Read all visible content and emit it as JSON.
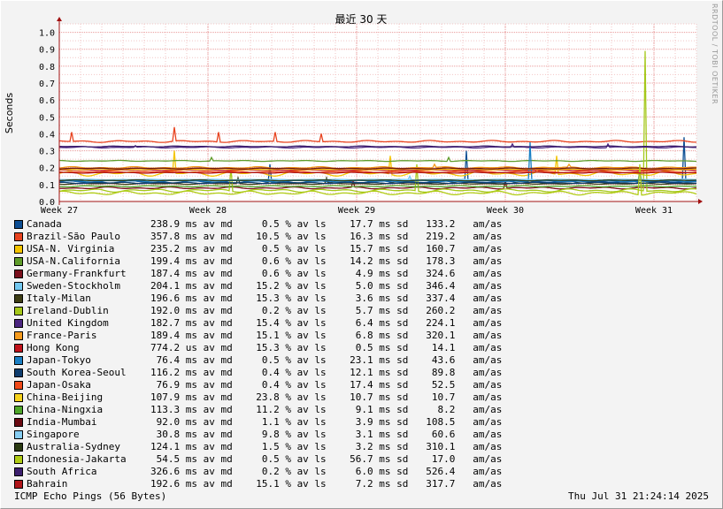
{
  "chart_data": {
    "type": "line",
    "title": "最近 30 天",
    "ylabel": "Seconds",
    "ylim": [
      0,
      1.05
    ],
    "yticks": [
      "0.0",
      "0.1",
      "0.2",
      "0.3",
      "0.4",
      "0.5",
      "0.6",
      "0.7",
      "0.8",
      "0.9",
      "1.0"
    ],
    "xticks": [
      "Week 27",
      "Week 28",
      "Week 29",
      "Week 30",
      "Week 31"
    ],
    "grid": true,
    "series": [
      {
        "name": "Canada",
        "color": "#0d4e93",
        "base": 0.115,
        "jitter": 0.008,
        "spikes": [
          [
            0.33,
            0.22
          ],
          [
            0.64,
            0.3
          ],
          [
            0.98,
            0.38
          ]
        ],
        "stats": "238.9 ms av md     0.5 % av ls    17.7 ms sd   133.2   am/as"
      },
      {
        "name": "Brazil-São Paulo",
        "color": "#e8431f",
        "base": 0.355,
        "jitter": 0.006,
        "spikes": [
          [
            0.02,
            0.41
          ],
          [
            0.18,
            0.44
          ],
          [
            0.25,
            0.41
          ],
          [
            0.34,
            0.41
          ],
          [
            0.41,
            0.4
          ]
        ],
        "stats": "357.8 ms av md    10.5 % av ls    16.3 ms sd   219.2   am/as"
      },
      {
        "name": "USA-N. Virginia",
        "color": "#f4c400",
        "base": 0.165,
        "jitter": 0.015,
        "spikes": [
          [
            0.18,
            0.3
          ],
          [
            0.52,
            0.27
          ],
          [
            0.78,
            0.27
          ]
        ],
        "stats": "235.2 ms av md     0.5 % av ls    15.7 ms sd   160.7   am/as"
      },
      {
        "name": "USA-N.California",
        "color": "#5f9c2a",
        "base": 0.24,
        "jitter": 0.003,
        "spikes": [
          [
            0.24,
            0.26
          ],
          [
            0.61,
            0.26
          ]
        ],
        "stats": "199.4 ms av md     0.6 % av ls    14.2 ms sd   178.3   am/as"
      },
      {
        "name": "Germany-Frankfurt",
        "color": "#7a0f1c",
        "base": 0.08,
        "jitter": 0.006,
        "spikes": [
          [
            0.46,
            0.12
          ],
          [
            0.7,
            0.12
          ]
        ],
        "stats": "187.4 ms av md     0.6 % av ls     4.9 ms sd   324.6   am/as"
      },
      {
        "name": "Sweden-Stockholm",
        "color": "#73c8f0",
        "base": 0.125,
        "jitter": 0.003,
        "spikes": [
          [
            0.55,
            0.15
          ]
        ],
        "stats": "204.1 ms av md    15.2 % av ls     5.0 ms sd   346.4   am/as"
      },
      {
        "name": "Italy-Milan",
        "color": "#3d3d14",
        "base": 0.105,
        "jitter": 0.004,
        "spikes": [
          [
            0.28,
            0.14
          ],
          [
            0.42,
            0.14
          ]
        ],
        "stats": "196.6 ms av md    15.3 % av ls     3.6 ms sd   337.4   am/as"
      },
      {
        "name": "Ireland-Dublin",
        "color": "#a5c81a",
        "base": 0.065,
        "jitter": 0.01,
        "spikes": [
          [
            0.27,
            0.2
          ],
          [
            0.56,
            0.22
          ],
          [
            0.92,
            0.89
          ]
        ],
        "stats": "192.0 ms av md     0.2 % av ls     5.7 ms sd   260.2   am/as"
      },
      {
        "name": "United Kingdom",
        "color": "#4b2580",
        "base": 0.32,
        "jitter": 0.004,
        "spikes": [
          [
            0.12,
            0.33
          ],
          [
            0.71,
            0.34
          ],
          [
            0.86,
            0.34
          ]
        ],
        "stats": "182.7 ms av md    15.4 % av ls     6.4 ms sd   224.1   am/as"
      },
      {
        "name": "France-Paris",
        "color": "#f59a1d",
        "base": 0.2,
        "jitter": 0.006,
        "spikes": [
          [
            0.59,
            0.22
          ],
          [
            0.8,
            0.22
          ]
        ],
        "stats": "189.4 ms av md    15.1 % av ls     6.8 ms sd   320.1   am/as"
      },
      {
        "name": "Hong Kong",
        "color": "#c1121b",
        "base": 0.185,
        "jitter": 0.002,
        "spikes": [],
        "stats": "774.2 us av md    15.3 % av ls     0.5 ms sd    14.1   am/as"
      },
      {
        "name": "Japan-Tokyo",
        "color": "#1a7fc4",
        "base": 0.12,
        "jitter": 0.005,
        "spikes": [
          [
            0.74,
            0.35
          ],
          [
            0.91,
            0.18
          ]
        ],
        "stats": " 76.4 ms av md     0.5 % av ls    23.1 ms sd    43.6   am/as"
      },
      {
        "name": "South Korea-Seoul",
        "color": "#0f3d6e",
        "base": 0.11,
        "jitter": 0.004,
        "spikes": [],
        "stats": "116.2 ms av md     0.4 % av ls    12.1 ms sd    89.8   am/as"
      },
      {
        "name": "Japan-Osaka",
        "color": "#f04a1a",
        "base": 0.175,
        "jitter": 0.004,
        "spikes": [
          [
            0.75,
            0.19
          ]
        ],
        "stats": " 76.9 ms av md     0.4 % av ls    17.4 ms sd    52.5   am/as"
      },
      {
        "name": "China-Beijing",
        "color": "#f6d21c",
        "base": 0.19,
        "jitter": 0.003,
        "spikes": [],
        "stats": "107.9 ms av md    23.8 % av ls    10.7 ms sd    10.7   am/as"
      },
      {
        "name": "China-Ningxia",
        "color": "#4fa62a",
        "base": 0.09,
        "jitter": 0.004,
        "spikes": [],
        "stats": "113.3 ms av md    11.2 % av ls     9.1 ms sd     8.2   am/as"
      },
      {
        "name": "India-Mumbai",
        "color": "#6a0a12",
        "base": 0.195,
        "jitter": 0.003,
        "spikes": [],
        "stats": " 92.0 ms av md     1.1 % av ls     3.9 ms sd   108.5   am/as"
      },
      {
        "name": "Singapore",
        "color": "#86cdf2",
        "base": 0.13,
        "jitter": 0.002,
        "spikes": [],
        "stats": " 30.8 ms av md     9.8 % av ls     3.1 ms sd    60.6   am/as"
      },
      {
        "name": "Australia-Sydney",
        "color": "#2b3a12",
        "base": 0.125,
        "jitter": 0.003,
        "spikes": [],
        "stats": "124.1 ms av md     1.5 % av ls     3.2 ms sd   310.1   am/as"
      },
      {
        "name": "Indonesia-Jakarta",
        "color": "#b0cc16",
        "base": 0.05,
        "jitter": 0.012,
        "spikes": [
          [
            0.91,
            0.22
          ]
        ],
        "stats": " 54.5 ms av md     0.5 % av ls    56.7 ms sd    17.0   am/as"
      },
      {
        "name": "South Africa",
        "color": "#3c1f6e",
        "base": 0.325,
        "jitter": 0.003,
        "spikes": [],
        "stats": "326.6 ms av md     0.2 % av ls     6.0 ms sd   526.4   am/as"
      },
      {
        "name": "Bahrain",
        "color": "#b0151a",
        "base": 0.17,
        "jitter": 0.003,
        "spikes": [],
        "stats": "192.6 ms av md    15.1 % av ls     7.2 ms sd   317.7   am/as"
      }
    ]
  },
  "footer": {
    "left": "ICMP Echo Pings (56 Bytes)",
    "right": "Thu Jul 31 21:24:14 2025"
  },
  "watermark": "RRDTOOL / TOBI OETIKER"
}
